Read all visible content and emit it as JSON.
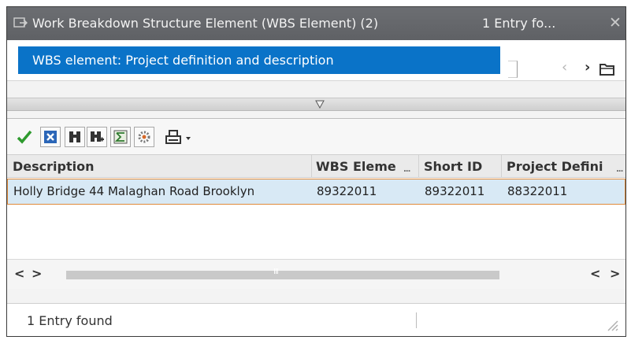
{
  "window": {
    "title": "Work Breakdown Structure Element (WBS Element) (2)",
    "entry_count": "1 Entry fo...",
    "close_glyph": "✕",
    "icon": "dialog-icon"
  },
  "search": {
    "dropdown_selected": "WBS element: Project definition and description",
    "nav_prev": "‹",
    "nav_next": "›",
    "folder_icon": "folder-icon"
  },
  "toolbar": {
    "buttons": [
      {
        "name": "accept",
        "icon": "checkmark-icon",
        "color": "#2e9a2e"
      },
      {
        "name": "cancel",
        "icon": "cancel-icon",
        "color": "#2b66b8"
      },
      {
        "name": "find",
        "icon": "binoculars-icon"
      },
      {
        "name": "find-next",
        "icon": "binoculars-plus-icon"
      },
      {
        "name": "sum",
        "icon": "sum-icon"
      },
      {
        "name": "settings",
        "icon": "settings-icon"
      },
      {
        "name": "print",
        "icon": "printer-icon"
      }
    ]
  },
  "table": {
    "columns": [
      "Description",
      "WBS Eleme",
      "Short ID",
      "Project Defini"
    ],
    "rows": [
      {
        "description": "Holly Bridge 44 Malaghan Road Brooklyn",
        "wbs_element": "89322011",
        "short_id": "89322011",
        "project_definition": "88322011"
      }
    ],
    "selected_row_color": "#d8e9f5",
    "selected_border_color": "#e08a3a"
  },
  "scroll": {
    "left": "<",
    "right": ">",
    "grip": "III"
  },
  "status": {
    "text": "1 Entry found"
  }
}
